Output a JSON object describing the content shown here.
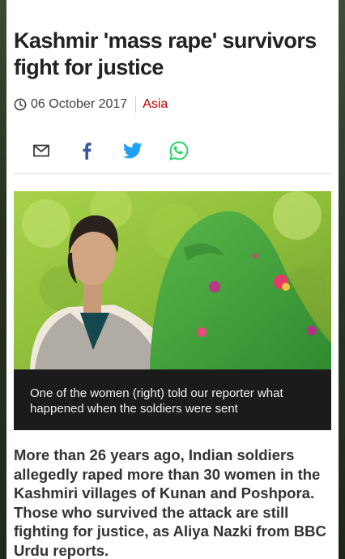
{
  "article": {
    "headline": "Kashmir 'mass rape' survivors fight for justice",
    "date": "06 October 2017",
    "section": "Asia",
    "caption": "One of the women (right) told our reporter what happened when the soldiers were sent",
    "intro": "More than 26 years ago, Indian soldiers allegedly raped more than 30 women in the Kashmiri villages of Kunan and Poshpora. Those who survived the attack are still fighting for justice, as Aliya Nazki from BBC Urdu reports."
  },
  "share": {
    "icons": [
      "email-icon",
      "facebook-icon",
      "twitter-icon",
      "whatsapp-icon"
    ]
  },
  "colors": {
    "section_accent": "#b80000",
    "twitter": "#1da1f2",
    "facebook": "#3b5998",
    "whatsapp": "#25d366"
  }
}
